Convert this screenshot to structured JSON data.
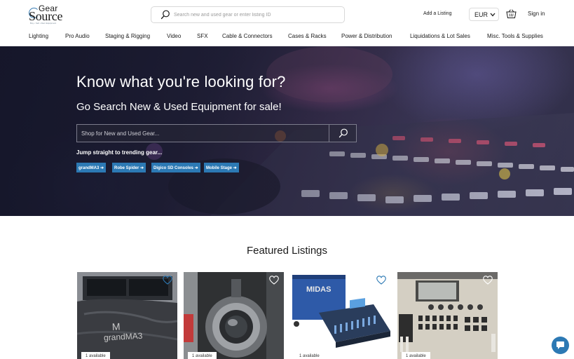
{
  "header": {
    "logo": {
      "gear": "Gear",
      "source": "Source",
      "tagline": "Buy • Sell • Rent Equipment"
    },
    "search": {
      "placeholder": "Search new and used gear or enter listing ID"
    },
    "add_listing": "Add a Listing",
    "currency": "EUR",
    "sign_in": "Sign in"
  },
  "nav": {
    "items": [
      "Lighting",
      "Pro Audio",
      "Staging & Rigging",
      "Video",
      "SFX",
      "Cable & Connectors",
      "Cases & Racks",
      "Power & Distribution",
      "Liquidations & Lot Sales",
      "Misc. Tools & Supplies"
    ]
  },
  "hero": {
    "title": "Know what you're looking for?",
    "subtitle": "Go Search New & Used Equipment for sale!",
    "search_placeholder": "Shop for New and Used Gear...",
    "trending_label": "Jump straight to trending gear...",
    "chips": [
      "grandMA3 ➜",
      "Robe Spider ➜",
      "Digico SD Consoles ➜",
      "Mobile Stage ➜"
    ]
  },
  "featured": {
    "title": "Featured Listings",
    "cards": [
      {
        "availability": "1 available",
        "icon": "heart-icon"
      },
      {
        "availability": "1 available",
        "icon": "heart-icon"
      },
      {
        "availability": "1 available",
        "icon": "heart-icon"
      },
      {
        "availability": "1 available",
        "icon": "heart-icon"
      }
    ]
  },
  "colors": {
    "accent": "#2c79b4",
    "text": "#1b1b1b",
    "border": "#d8d8d8"
  },
  "chat": {
    "icon": "chat-bubble-icon"
  }
}
